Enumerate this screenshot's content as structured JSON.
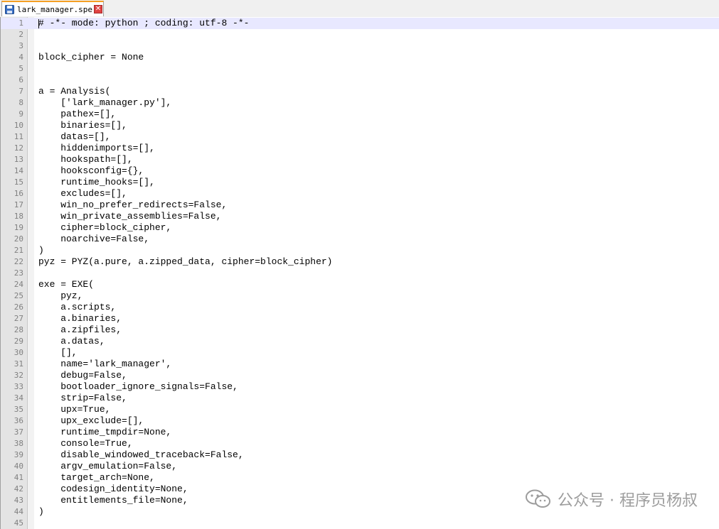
{
  "tab": {
    "title": "lark_manager.spec",
    "close_glyph": "✕",
    "icon": "save-icon"
  },
  "code_lines": [
    "# -*- mode: python ; coding: utf-8 -*-",
    "",
    "",
    "block_cipher = None",
    "",
    "",
    "a = Analysis(",
    "    ['lark_manager.py'],",
    "    pathex=[],",
    "    binaries=[],",
    "    datas=[],",
    "    hiddenimports=[],",
    "    hookspath=[],",
    "    hooksconfig={},",
    "    runtime_hooks=[],",
    "    excludes=[],",
    "    win_no_prefer_redirects=False,",
    "    win_private_assemblies=False,",
    "    cipher=block_cipher,",
    "    noarchive=False,",
    ")",
    "pyz = PYZ(a.pure, a.zipped_data, cipher=block_cipher)",
    "",
    "exe = EXE(",
    "    pyz,",
    "    a.scripts,",
    "    a.binaries,",
    "    a.zipfiles,",
    "    a.datas,",
    "    [],",
    "    name='lark_manager',",
    "    debug=False,",
    "    bootloader_ignore_signals=False,",
    "    strip=False,",
    "    upx=True,",
    "    upx_exclude=[],",
    "    runtime_tmpdir=None,",
    "    console=True,",
    "    disable_windowed_traceback=False,",
    "    argv_emulation=False,",
    "    target_arch=None,",
    "    codesign_identity=None,",
    "    entitlements_file=None,",
    ")",
    ""
  ],
  "current_line": 1,
  "watermark": {
    "text": "公众号 · 程序员杨叔",
    "icon": "wechat-icon"
  },
  "colors": {
    "current_line_bg": "#e8e8ff",
    "gutter_bg": "#e4e4e4",
    "tab_accent": "#f5a023",
    "close_button": "#e04343"
  }
}
